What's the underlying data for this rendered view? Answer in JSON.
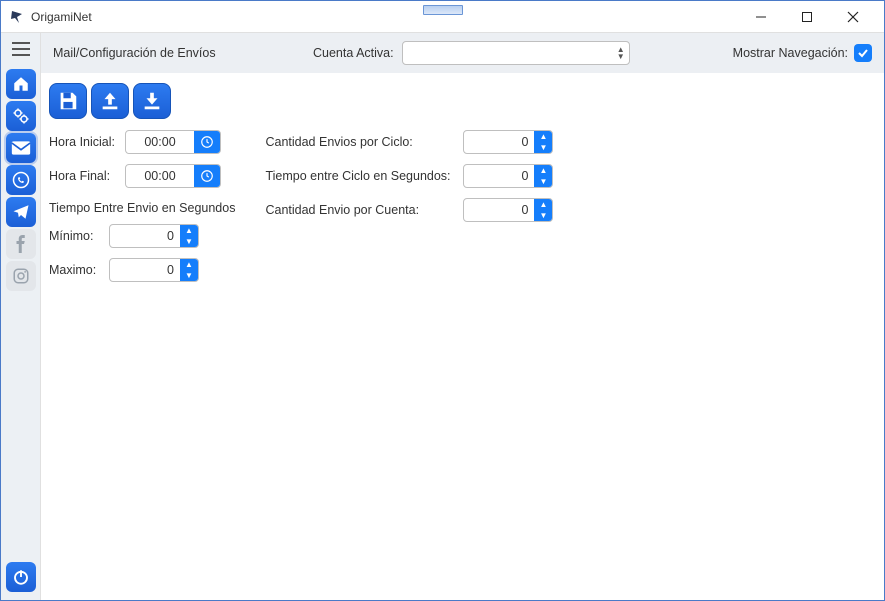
{
  "window": {
    "title": "OrigamiNet"
  },
  "toolbar": {
    "breadcrumb": "Mail/Configuración de Envíos",
    "account_label": "Cuenta Activa:",
    "account_value": "",
    "nav_label": "Mostrar Navegación:",
    "nav_checked": true
  },
  "actions": {
    "save": "save",
    "upload": "upload",
    "download": "download"
  },
  "form": {
    "hora_inicial_label": "Hora Inicial:",
    "hora_inicial_value": "00:00",
    "hora_final_label": "Hora Final:",
    "hora_final_value": "00:00",
    "between_section": "Tiempo Entre Envio en Segundos",
    "minimo_label": "Mínimo:",
    "minimo_value": "0",
    "maximo_label": "Maximo:",
    "maximo_value": "0",
    "cant_ciclo_label": "Cantidad Envios por Ciclo:",
    "cant_ciclo_value": "0",
    "tiempo_ciclo_label": "Tiempo entre Ciclo en Segundos:",
    "tiempo_ciclo_value": "0",
    "cant_cuenta_label": "Cantidad Envio por Cuenta:",
    "cant_cuenta_value": "0"
  },
  "sidebar": {
    "items": [
      "home",
      "settings",
      "mail",
      "whatsapp",
      "telegram",
      "facebook",
      "instagram"
    ],
    "bottom": "power"
  }
}
